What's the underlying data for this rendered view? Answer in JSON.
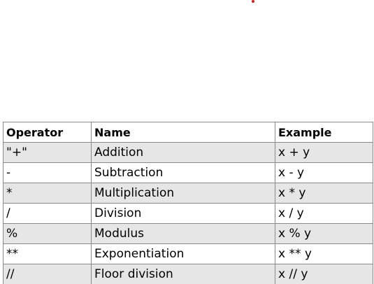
{
  "table": {
    "headers": [
      "Operator",
      "Name",
      "Example"
    ],
    "rows": [
      [
        "\"+\"",
        "Addition",
        "x + y"
      ],
      [
        "-",
        "Subtraction",
        "x - y"
      ],
      [
        "*",
        "Multiplication",
        "x * y"
      ],
      [
        "/",
        "Division",
        "x / y"
      ],
      [
        "%",
        "Modulus",
        "x % y"
      ],
      [
        "**",
        "Exponentiation",
        "x ** y"
      ],
      [
        "//",
        "Floor division",
        "x // y"
      ]
    ]
  },
  "colors": {
    "stripe": "#e6e6e6",
    "border": "#8a8a8a",
    "dot": "#d62020"
  }
}
